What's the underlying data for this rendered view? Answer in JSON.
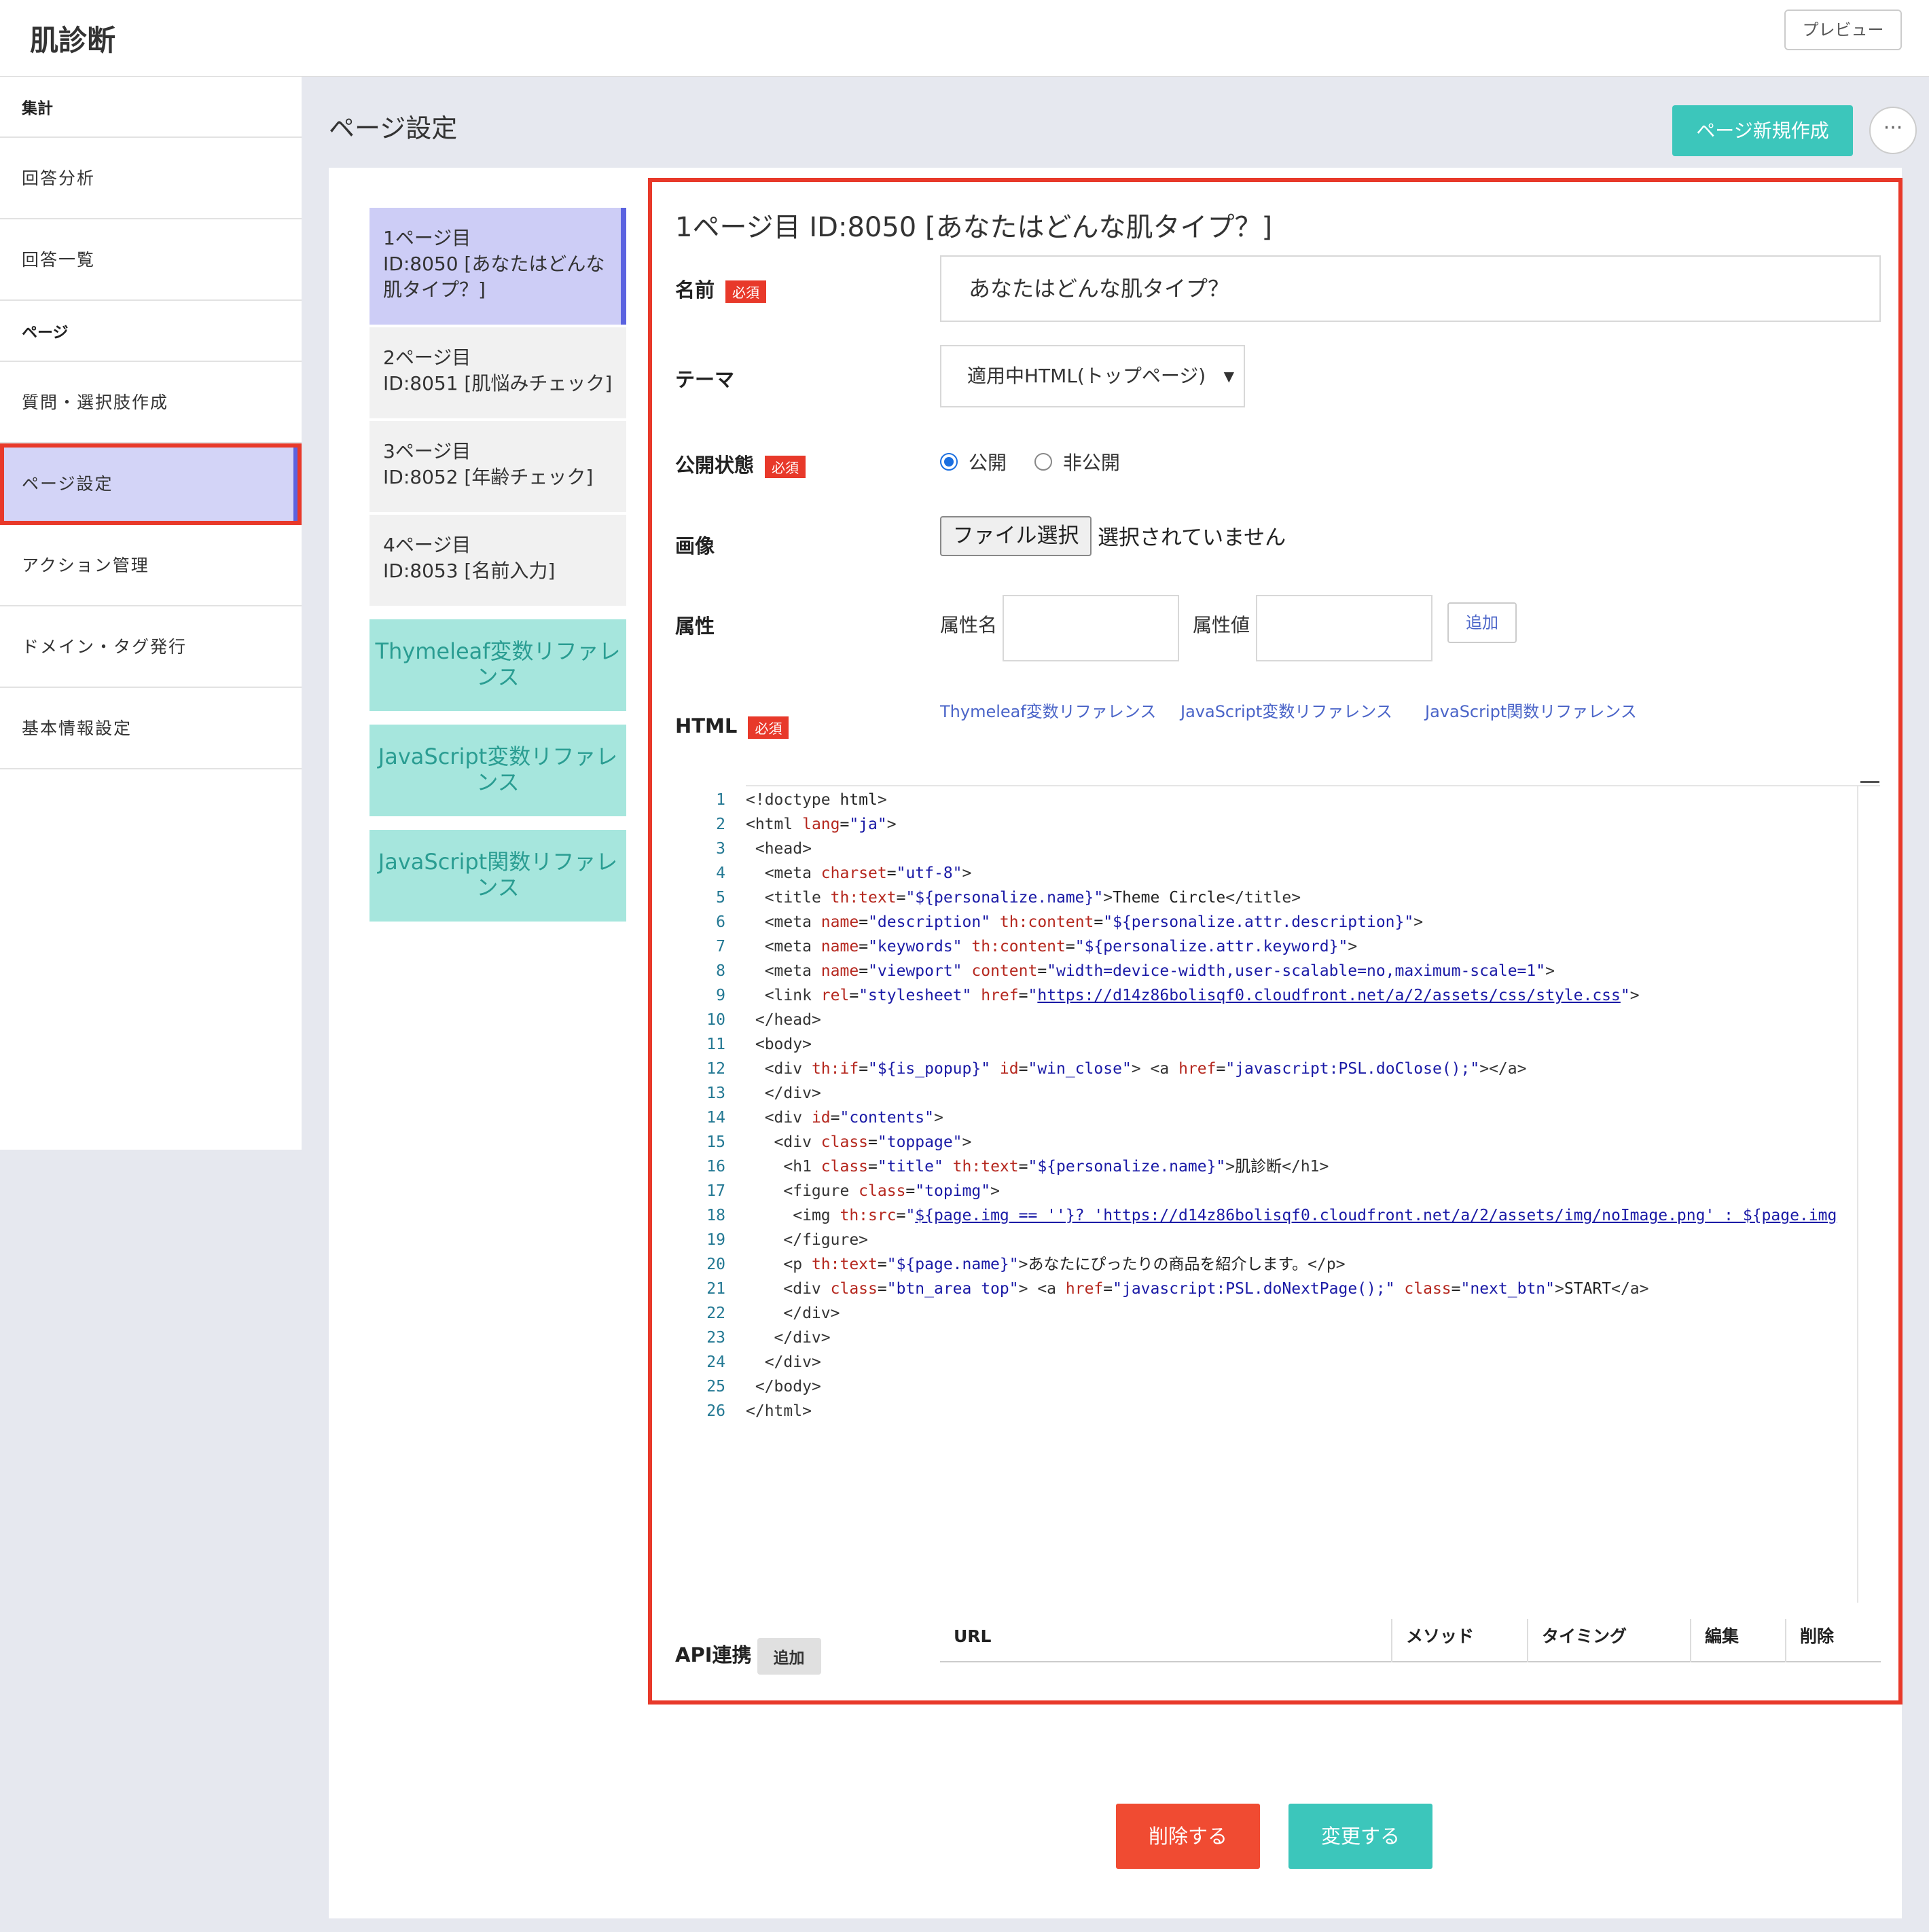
{
  "app": {
    "title": "肌診断",
    "preview_label": "プレビュー"
  },
  "sidebar": {
    "sections": [
      {
        "label": "集計",
        "items": [
          "回答分析",
          "回答一覧"
        ]
      },
      {
        "label": "ページ",
        "items": [
          "質問・選択肢作成",
          "ページ設定",
          "アクション管理",
          "ドメイン・タグ発行",
          "基本情報設定"
        ]
      }
    ],
    "active_item": "ページ設定"
  },
  "main": {
    "heading": "ページ設定",
    "new_page_label": "ページ新規作成",
    "more_label": "···"
  },
  "pages": [
    {
      "l1": "1ページ目",
      "l2": "ID:8050 [あなたはどんな",
      "l3": "肌タイプ？]"
    },
    {
      "l1": "2ページ目",
      "l2": "ID:8051 [肌悩みチェック]",
      "l3": ""
    },
    {
      "l1": "3ページ目",
      "l2": "ID:8052 [年齢チェック]",
      "l3": ""
    },
    {
      "l1": "4ページ目",
      "l2": "ID:8053 [名前入力]",
      "l3": ""
    }
  ],
  "ref_buttons": [
    {
      "l1": "Thymeleaf変数リファレ",
      "l2": "ンス"
    },
    {
      "l1": "JavaScript変数リファレ",
      "l2": "ンス"
    },
    {
      "l1": "JavaScript関数リファレ",
      "l2": "ンス"
    }
  ],
  "form": {
    "title": "1ページ目  ID:8050 [あなたはどんな肌タイプ？]",
    "required_badge": "必須",
    "name_label": "名前",
    "name_value": "あなたはどんな肌タイプ？",
    "theme_label": "テーマ",
    "theme_value": "適用中HTML(トップページ)",
    "status_label": "公開状態",
    "status_options": [
      "公開",
      "非公開"
    ],
    "status_selected": "公開",
    "image_label": "画像",
    "file_button": "ファイル選択",
    "file_status": "選択されていません",
    "attr_label": "属性",
    "attr_name_label": "属性名",
    "attr_value_label": "属性値",
    "add_label": "追加",
    "html_label": "HTML",
    "ref_links": [
      "Thymeleaf変数リファレンス",
      "JavaScript変数リファレンス",
      "JavaScript関数リファレンス"
    ],
    "api_label": "API連携",
    "api_add_label": "追加",
    "api_columns": [
      "URL",
      "メソッド",
      "タイミング",
      "編集",
      "削除"
    ]
  },
  "code_lines": [
    "<!doctype html>",
    "<html lang=\"ja\">",
    " <head>",
    "  <meta charset=\"utf-8\">",
    "  <title th:text=\"${personalize.name}\">Theme Circle</title>",
    "  <meta name=\"description\" th:content=\"${personalize.attr.description}\">",
    "  <meta name=\"keywords\" th:content=\"${personalize.attr.keyword}\">",
    "  <meta name=\"viewport\" content=\"width=device-width,user-scalable=no,maximum-scale=1\">",
    "  <link rel=\"stylesheet\" href=\"https://d14z86bolisqf0.cloudfront.net/a/2/assets/css/style.css\">",
    " </head>",
    " <body>",
    "  <div th:if=\"${is_popup}\" id=\"win_close\"> <a href=\"javascript:PSL.doClose();\"></a>",
    "  </div>",
    "  <div id=\"contents\">",
    "   <div class=\"toppage\">",
    "    <h1 class=\"title\" th:text=\"${personalize.name}\">肌診断</h1>",
    "    <figure class=\"topimg\">",
    "     <img th:src=\"${page.img == ''}? 'https://d14z86bolisqf0.cloudfront.net/a/2/assets/img/noImage.png' : ${page.img",
    "    </figure>",
    "    <p th:text=\"${page.name}\">あなたにぴったりの商品を紹介します。</p>",
    "    <div class=\"btn_area top\"> <a href=\"javascript:PSL.doNextPage();\" class=\"next_btn\">START</a>",
    "    </div>",
    "   </div>",
    "  </div>",
    " </body>",
    "</html>"
  ],
  "actions": {
    "delete_label": "削除する",
    "change_label": "変更する"
  },
  "colors": {
    "accent": "#3cc6bb",
    "danger": "#f04b32",
    "highlight": "#e8392a",
    "active_bg": "#d3d4f7"
  }
}
